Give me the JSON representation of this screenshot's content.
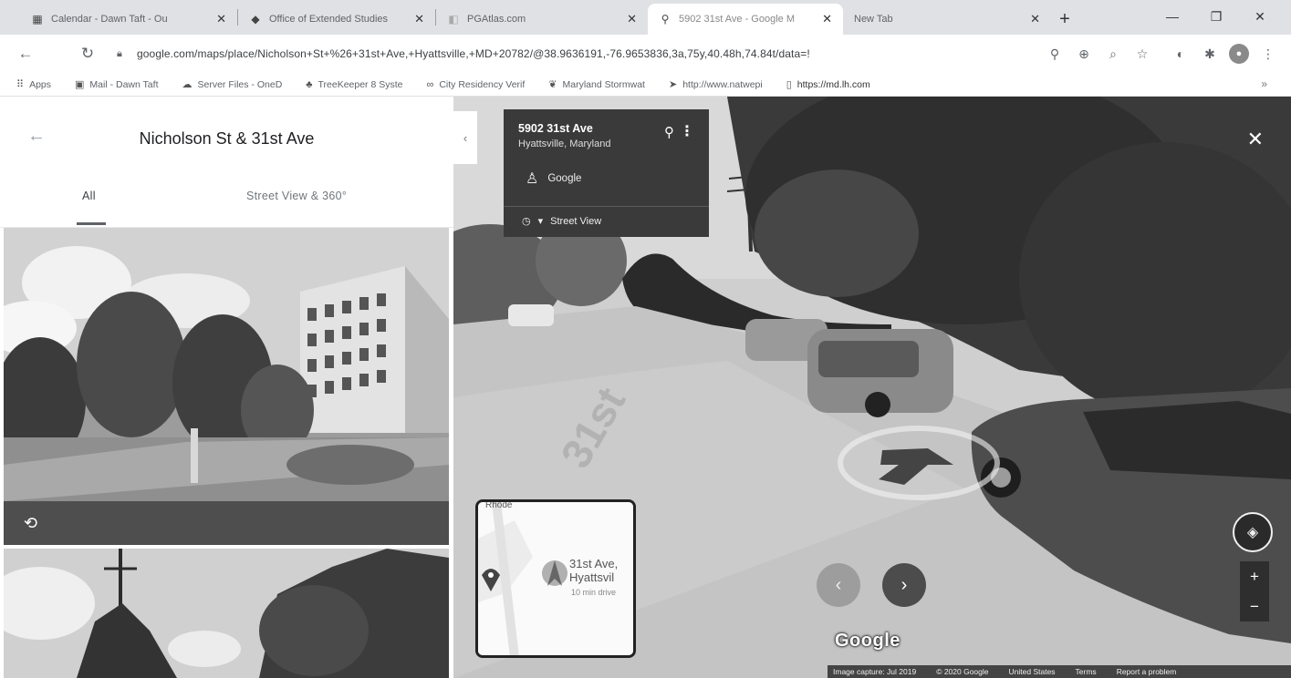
{
  "browser": {
    "tabs": [
      {
        "title": "Calendar - Dawn Taft - Ou",
        "icon": "calendar-icon",
        "active": false
      },
      {
        "title": "Office of Extended Studies",
        "icon": "office-icon",
        "active": false
      },
      {
        "title": "PGAtlas.com",
        "icon": "pgatlas-icon",
        "active": false
      },
      {
        "title": "5902 31st Ave - Google M",
        "icon": "maps-pin-icon",
        "active": true
      },
      {
        "title": "New Tab",
        "icon": "newtab-icon",
        "active": false
      }
    ],
    "window_controls": {
      "minimize": "—",
      "restore": "❐",
      "close": "✕"
    },
    "url": "google.com/maps/place/Nicholson+St+%26+31st+Ave,+Hyattsville,+MD+20782/@38.9636191,-76.9653836,3a,75y,40.48h,74.84t/data=!",
    "bookmarks": [
      {
        "label": "Apps",
        "icon": "apps-grid-icon"
      },
      {
        "label": "Mail - Dawn Taft",
        "icon": "mail-icon"
      },
      {
        "label": "Server Files - OneD",
        "icon": "cloud-icon"
      },
      {
        "label": "TreeKeeper 8 Syste",
        "icon": "tree-icon"
      },
      {
        "label": "City Residency Verif",
        "icon": "link-icon"
      },
      {
        "label": "Maryland Stormwat",
        "icon": "storm-icon"
      },
      {
        "label": "http://www.natwepi",
        "icon": "cursor-icon"
      },
      {
        "label": "https://md.lh.com",
        "icon": "page-icon"
      }
    ]
  },
  "left_panel": {
    "title": "Nicholson St & 31st Ave",
    "tabs": [
      "All",
      "Street View & 360°"
    ]
  },
  "street_view": {
    "address": "5902 31st Ave",
    "city": "Hyattsville, Maryland",
    "provider": "Google",
    "mode": "Street View",
    "minimap": {
      "street": "31st Ave,",
      "city": "Hyattsvil",
      "sub": "10 min drive",
      "top_label": "Rhode"
    },
    "watermark": "Google",
    "footer": [
      "Image capture: Jul 2019",
      "© 2020 Google",
      "United States",
      "Terms",
      "Report a problem"
    ]
  }
}
